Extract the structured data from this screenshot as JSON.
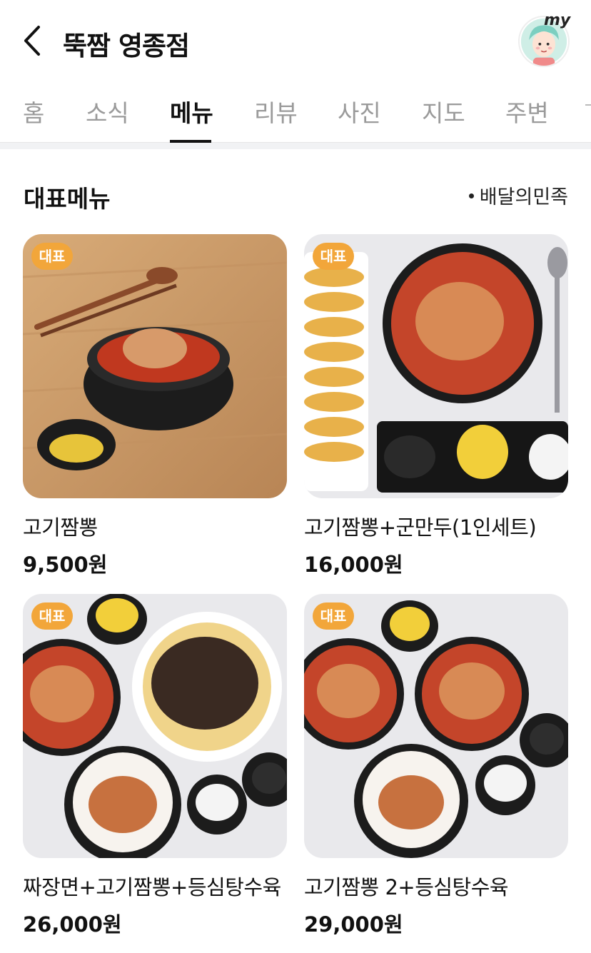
{
  "header": {
    "title": "뚝짬 영종점",
    "back_icon": "chevron-left-icon",
    "my_label": "my"
  },
  "tabs": [
    {
      "label": "홈",
      "active": false
    },
    {
      "label": "소식",
      "active": false
    },
    {
      "label": "메뉴",
      "active": true
    },
    {
      "label": "리뷰",
      "active": false
    },
    {
      "label": "사진",
      "active": false
    },
    {
      "label": "지도",
      "active": false
    },
    {
      "label": "주변",
      "active": false
    }
  ],
  "section": {
    "title": "대표메뉴",
    "source": "배달의민족"
  },
  "colors": {
    "badge": "#f2a63a",
    "active_tab": "#111111",
    "inactive_tab": "#9a9a9a"
  },
  "menu_items": [
    {
      "badge": "대표",
      "name": "고기짬뽕",
      "price": "9,500원"
    },
    {
      "badge": "대표",
      "name": "고기짬뽕+군만두(1인세트)",
      "price": "16,000원"
    },
    {
      "badge": "대표",
      "name": "짜장면+고기짬뽕+등심탕수육",
      "price": "26,000원"
    },
    {
      "badge": "대표",
      "name": "고기짬뽕 2+등심탕수육",
      "price": "29,000원"
    }
  ]
}
